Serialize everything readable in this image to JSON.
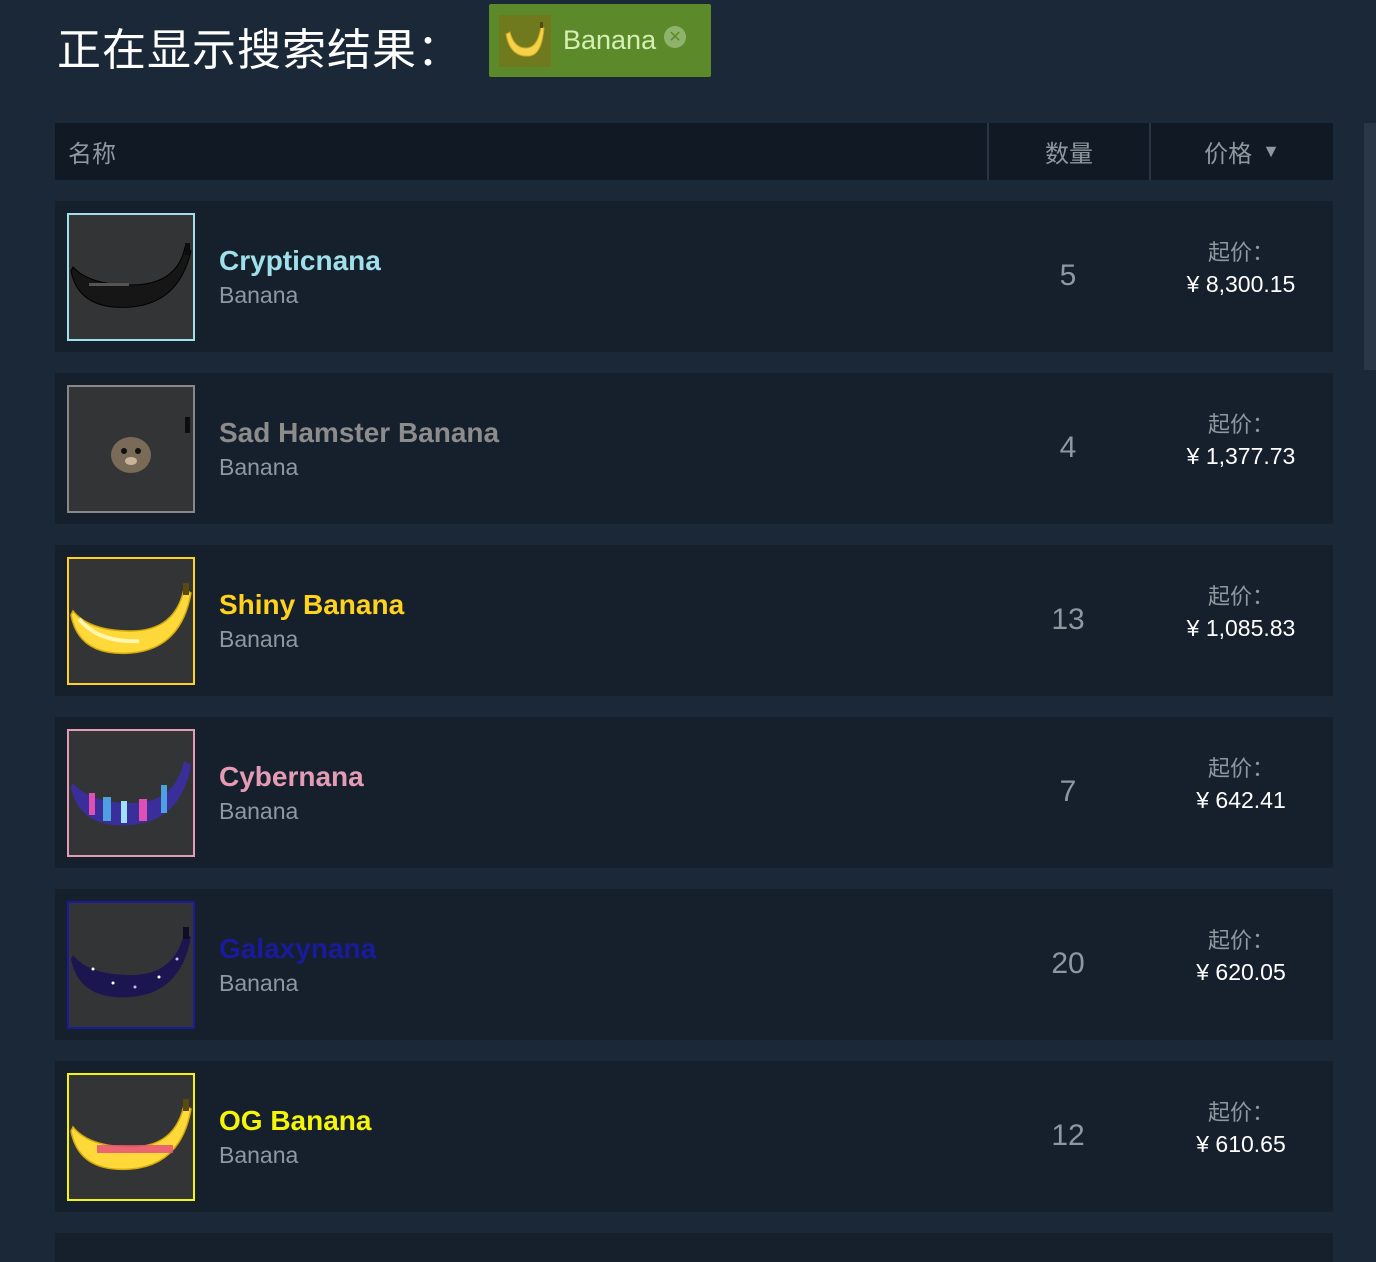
{
  "heading": "正在显示搜索结果：",
  "filter_chip": {
    "label": "Banana",
    "remove_icon": "close-circle-icon"
  },
  "table_header": {
    "name": "名称",
    "quantity": "数量",
    "price": "价格",
    "sort_indicator": "▼"
  },
  "rows": [
    {
      "name": "Crypticnana",
      "name_color": "#9fe0ea",
      "border_color": "#9fe0ea",
      "game": "Banana",
      "quantity": "5",
      "price_label": "起价：",
      "price": "¥ 8,300.15",
      "thumb_icon": "black-banana-icon"
    },
    {
      "name": "Sad Hamster Banana",
      "name_color": "#8c8c8c",
      "border_color": "#888888",
      "game": "Banana",
      "quantity": "4",
      "price_label": "起价：",
      "price": "¥ 1,377.73",
      "thumb_icon": "hamster-banana-icon"
    },
    {
      "name": "Shiny Banana",
      "name_color": "#ffd21e",
      "border_color": "#ffd21e",
      "game": "Banana",
      "quantity": "13",
      "price_label": "起价：",
      "price": "¥ 1,085.83",
      "thumb_icon": "shiny-banana-icon"
    },
    {
      "name": "Cybernana",
      "name_color": "#e39cb3",
      "border_color": "#e39cb3",
      "game": "Banana",
      "quantity": "7",
      "price_label": "起价：",
      "price": "¥ 642.41",
      "thumb_icon": "cyber-banana-icon"
    },
    {
      "name": "Galaxynana",
      "name_color": "#1a1a9c",
      "border_color": "#1a1a9c",
      "game": "Banana",
      "quantity": "20",
      "price_label": "起价：",
      "price": "¥ 620.05",
      "thumb_icon": "galaxy-banana-icon"
    },
    {
      "name": "OG Banana",
      "name_color": "#f5f50a",
      "border_color": "#f5f50a",
      "game": "Banana",
      "quantity": "12",
      "price_label": "起价：",
      "price": "¥ 610.65",
      "thumb_icon": "og-banana-icon"
    }
  ]
}
